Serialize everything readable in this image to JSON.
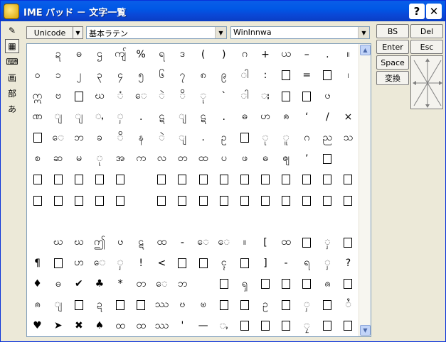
{
  "window": {
    "title": "IME パッド － 文字一覧",
    "help_label": "?",
    "close_label": "✕"
  },
  "toolstrip": [
    {
      "name": "handwriting-tool",
      "glyph": "✎"
    },
    {
      "name": "character-list-tool",
      "glyph": "▦"
    },
    {
      "name": "soft-keyboard-tool",
      "glyph": "⌨"
    },
    {
      "name": "total-stroke-tool",
      "glyph": "画"
    },
    {
      "name": "radical-tool",
      "glyph": "部"
    },
    {
      "name": "kana-tool",
      "glyph": "あ"
    }
  ],
  "controls": {
    "unicode_label": "Unicode",
    "charset_value": "基本ラテン",
    "font_value": "WinInnwa"
  },
  "keys": {
    "bs": "BS",
    "del": "Del",
    "enter": "Enter",
    "esc": "Esc",
    "space": "Space",
    "convert": "変換"
  },
  "grid": {
    "cols": 16,
    "rows": [
      [
        " ",
        "ဍ",
        "ဓ",
        "ဌ",
        "ကျ်",
        "%",
        "ရ",
        "ဒ",
        "(",
        ")",
        "ဂ",
        "+",
        "ယ",
        "–",
        ".",
        "။"
      ],
      [
        "ဝ",
        "၁",
        "၂",
        "၃",
        "၄",
        "၅",
        "၆",
        "၇",
        "၈",
        "၉",
        "ါ",
        ":",
        "□",
        "=",
        "□",
        "၊"
      ],
      [
        "ဣ",
        "ဗ",
        "□",
        "ဃ",
        "ံ",
        "ေ",
        "ဲ",
        "ိ",
        "ု",
        "`",
        "ါ",
        "ႈ",
        "□",
        "□",
        "ၒ",
        " "
      ],
      [
        "ဏ",
        "ျ",
        "ျ",
        "ႇ",
        "ှ",
        ".",
        "ဋ",
        "ျ",
        "ဋ",
        ".",
        "ဓ",
        "ဟ",
        "ၐ",
        "‘",
        "/",
        "×"
      ],
      [
        "□",
        "ေ",
        "ဘ",
        "ခ",
        "ိ",
        "န",
        "ဲ",
        "ျ",
        ".",
        "ဥ",
        "□",
        "ု",
        "ူ",
        "ဂ",
        "ည",
        "သ"
      ],
      [
        "စ",
        "ဆ",
        "မ",
        "ု",
        "အ",
        "က",
        "လ",
        "တ",
        "ထ",
        "ပ",
        "ဖ",
        "ဓ",
        "ၛ",
        "’",
        "□",
        " "
      ],
      [
        "□",
        "□",
        "□",
        "□",
        "□",
        " ",
        "□",
        "□",
        "□",
        "□",
        "□",
        "□",
        "□",
        "□",
        "□",
        "□"
      ],
      [
        "□",
        "□",
        "□",
        "□",
        "□",
        " ",
        "□",
        "□",
        "□",
        "□",
        "□",
        "□",
        "□",
        "□",
        "□",
        "□"
      ],
      [
        " ",
        " ",
        " ",
        " ",
        " ",
        " ",
        " ",
        " ",
        " ",
        " ",
        " ",
        " ",
        " ",
        " ",
        " ",
        " "
      ],
      [
        " ",
        "ဃ",
        "ဃ",
        "ဤ",
        "ၒ",
        "ဋ",
        "ထ",
        "-",
        "ေ",
        "ေ",
        "။",
        "[",
        "ထ",
        "□",
        "ှ",
        "□"
      ],
      [
        "¶",
        "□",
        "ဟ",
        "ေ",
        "ှ",
        "!",
        "<",
        "□",
        "□",
        "ၚ",
        "□",
        "]",
        "-",
        "ရ",
        "ှ",
        "?"
      ],
      [
        "♦",
        "ဓ",
        "✔",
        "♣",
        "*",
        "တ",
        "ေ",
        "ဘ",
        " ",
        "□",
        "ၡ",
        "□",
        "□",
        "□",
        "ၐ",
        "□"
      ],
      [
        "ၐ",
        "ျ",
        "□",
        "ဍ",
        "□",
        "□",
        "ဿ",
        "ၓ",
        "ၑ",
        "□",
        "□",
        "ဥ",
        "□",
        "ှ",
        "□",
        "ႆ"
      ],
      [
        "♥",
        "➤",
        "✖",
        "♠",
        "ထ",
        "ထ",
        "ဿ",
        "'",
        "—",
        "ႇ",
        "□",
        "□",
        "□",
        "ၠ",
        "□",
        "□"
      ]
    ]
  }
}
